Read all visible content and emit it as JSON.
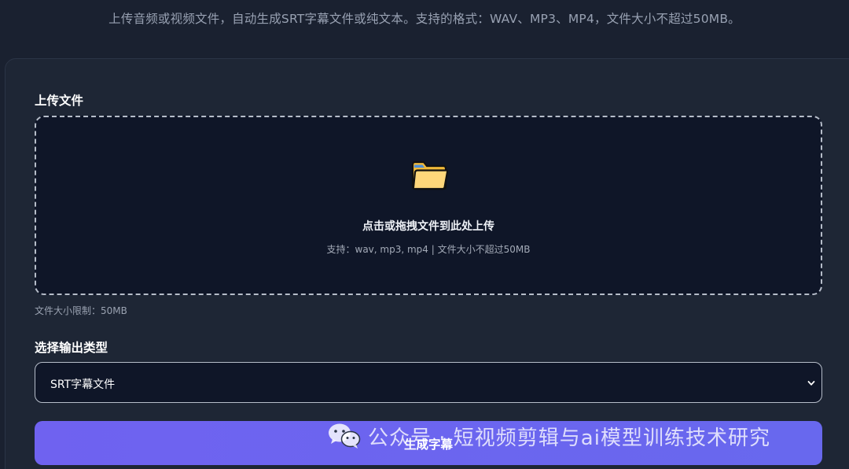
{
  "header": {
    "subtitle": "上传音频或视频文件，自动生成SRT字幕文件或纯文本。支持的格式：WAV、MP3、MP4，文件大小不超过50MB。"
  },
  "upload": {
    "label": "上传文件",
    "icon": "folder-icon",
    "title": "点击或拖拽文件到此处上传",
    "hint": "支持：wav, mp3, mp4 | 文件大小不超过50MB",
    "size_limit": "文件大小限制：50MB"
  },
  "output": {
    "label": "选择输出类型",
    "selected": "SRT字幕文件"
  },
  "actions": {
    "generate_label": "生成字幕"
  },
  "watermark": {
    "text": "公众号 · 短视频剪辑与ai模型训练技术研究",
    "icon": "wechat-icon"
  },
  "colors": {
    "background": "#1a2130",
    "card": "#1e2635",
    "dropzone": "#0f1628",
    "accent": "#6b64ef"
  }
}
